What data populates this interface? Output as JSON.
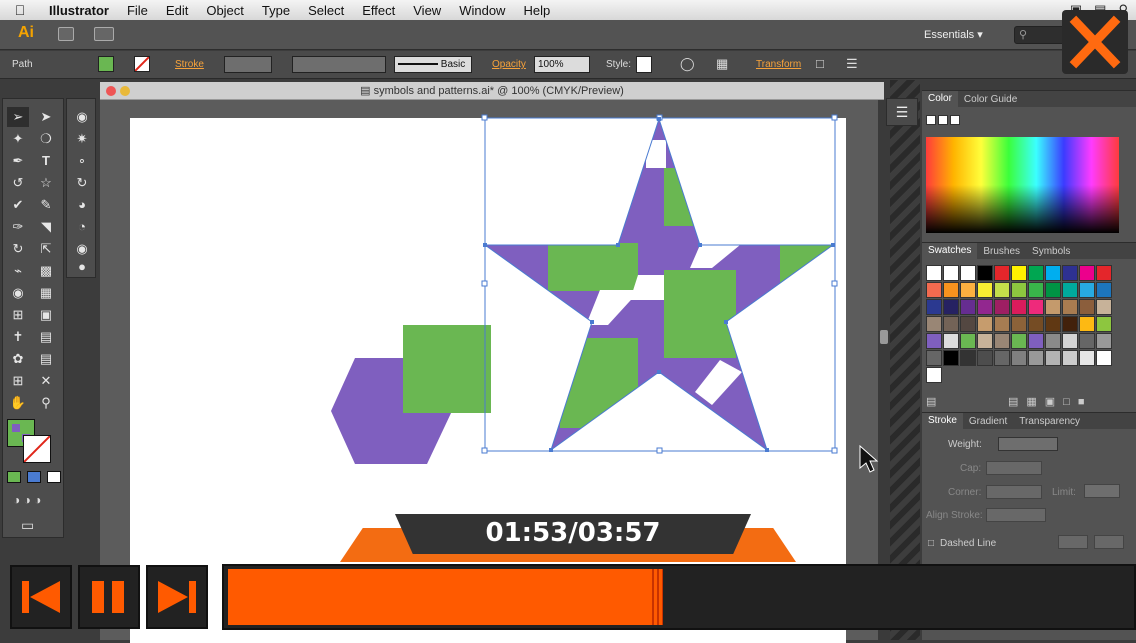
{
  "menubar": {
    "app_name": "Illustrator",
    "items": [
      "File",
      "Edit",
      "Object",
      "Type",
      "Select",
      "Effect",
      "View",
      "Window",
      "Help"
    ]
  },
  "appbar": {
    "logo": "Ai",
    "workspace": "Essentials",
    "workspace_arrow": "▾"
  },
  "controlbar": {
    "selection_type": "Path",
    "stroke_label": "Stroke",
    "brush_label": "Basic",
    "opacity_label": "Opacity",
    "opacity_value": "100%",
    "style_label": "Style:",
    "transform_label": "Transform"
  },
  "document": {
    "title": "symbols and patterns.ai* @ 100% (CMYK/Preview)"
  },
  "panels": {
    "color": {
      "tabs": [
        "Color",
        "Color Guide"
      ]
    },
    "swatches": {
      "tabs": [
        "Swatches",
        "Brushes",
        "Symbols"
      ]
    },
    "stroke": {
      "tabs": [
        "Stroke",
        "Gradient",
        "Transparency"
      ],
      "weight_label": "Weight:",
      "cap_label": "Cap:",
      "corner_label": "Corner:",
      "limit_label": "Limit:",
      "align_label": "Align Stroke:",
      "dashed_label": "Dashed Line"
    }
  },
  "colors": {
    "purple": "#7f5fbf",
    "green": "#6ab752",
    "orange": "#ff5a00",
    "selection": "#4a7bd1"
  },
  "player": {
    "time": "01:53/03:57",
    "progress": 0.478,
    "prev_icon": "skip-back-icon",
    "pause_icon": "pause-icon",
    "next_icon": "skip-forward-icon",
    "close_icon": "close-icon"
  }
}
